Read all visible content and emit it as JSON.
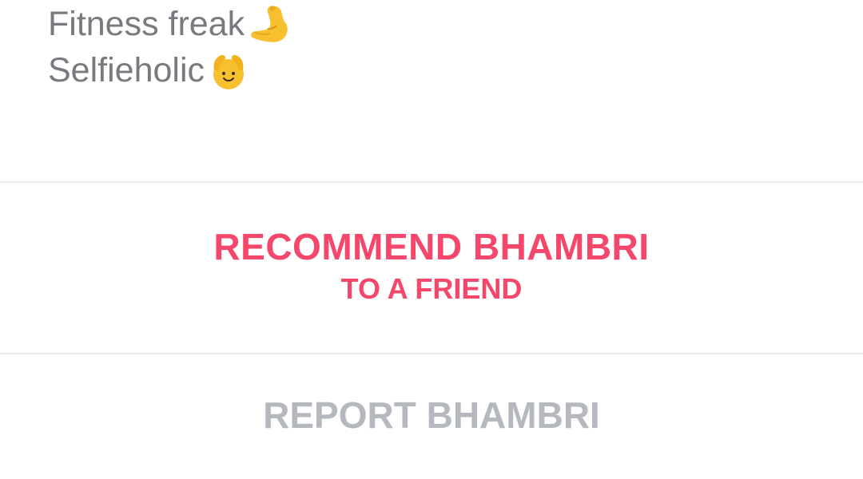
{
  "bio": {
    "lines": [
      {
        "text": "Fitness freak",
        "emoji": "flexed-biceps-icon"
      },
      {
        "text": "Selfieholic",
        "emoji": "hands-over-head-smiley-icon"
      }
    ]
  },
  "recommend": {
    "title": "RECOMMEND BHAMBRI",
    "subtitle": "TO A FRIEND"
  },
  "report": {
    "label": "REPORT BHAMBRI"
  },
  "colors": {
    "accent": "#f4476b",
    "report_text": "#b5b8bf",
    "bio_text": "#777a7e",
    "divider": "#ececec",
    "emoji_yellow": "#f7c02f"
  }
}
